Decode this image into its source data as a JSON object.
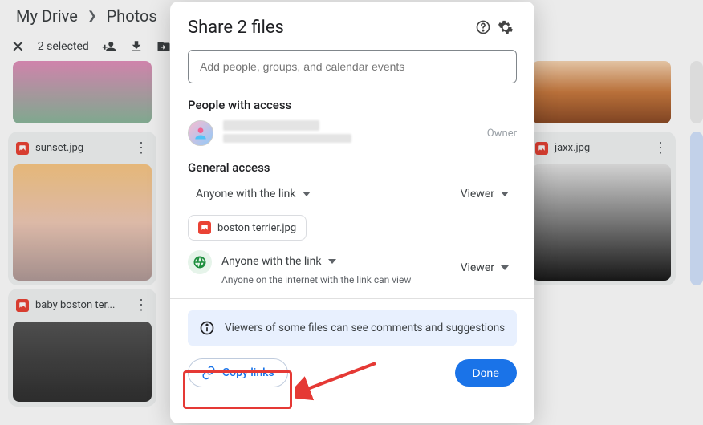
{
  "header": {
    "crumb_root": "My Drive",
    "crumb_leaf": "Photos"
  },
  "toolbar": {
    "selected_text": "2 selected"
  },
  "tiles": [
    {
      "name": "sunset.jpg"
    },
    {
      "name": "baby boston ter..."
    },
    {
      "name": "jaxx.jpg"
    }
  ],
  "dialog": {
    "title": "Share 2 files",
    "input_placeholder": "Add people, groups, and calendar events",
    "people_section": "People with access",
    "owner_label": "Owner",
    "general_section": "General access",
    "anyone_link": "Anyone with the link",
    "viewer_label": "Viewer",
    "file_chip": "boston terrier.jpg",
    "anyone_sub": "Anyone on the internet with the link can view",
    "banner_text": "Viewers of some files can see comments and suggestions",
    "copy_links": "Copy links",
    "done": "Done"
  }
}
